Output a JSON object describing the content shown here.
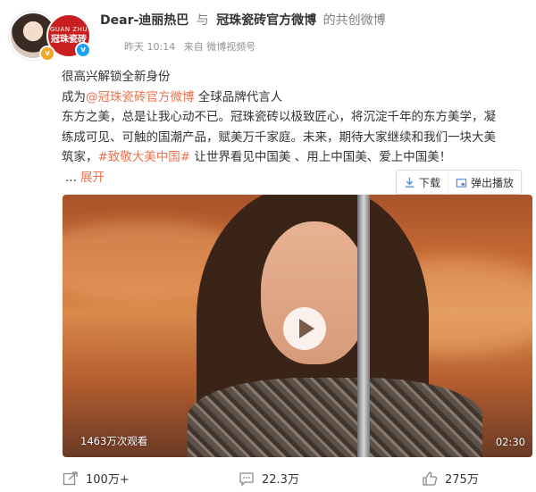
{
  "header": {
    "author": "Dear-迪丽热巴",
    "connector": "与",
    "coauthor": "冠珠瓷砖官方微博",
    "suffix": "的共创微博",
    "time": "昨天 10:14",
    "source": "来自 微博视频号",
    "brand_avatar_en": "GUAN ZHU",
    "brand_avatar_cn": "冠珠瓷砖"
  },
  "post": {
    "line1": "很高兴解锁全新身份",
    "line2_prefix": "成为",
    "line2_link": "@冠珠瓷砖官方微博",
    "line2_suffix": " 全球品牌代言人",
    "line3a": "东方之美，总是让我心动不已。冠珠瓷砖以极致匠心，将沉淀千年的东方美学，凝",
    "line3b": "练成可见、可触的国潮产品，赋美万千家庭。未来，期待大家继续和我们一块大美",
    "line3c_prefix": "筑家，",
    "hashtag": "#致敬大美中国#",
    "line3c_suffix": " 让世界看见中国美 、用上中国美、爱上中国美！",
    "ellipsis": "...",
    "expand": "展开"
  },
  "video_toolbar": {
    "download": "下载",
    "popout": "弹出播放"
  },
  "video": {
    "views": "1463万次观看",
    "duration": "02:30"
  },
  "actions": {
    "share_count": "100万+",
    "comment_count": "22.3万",
    "like_count": "275万"
  },
  "colors": {
    "link": "#eb7350",
    "brand": "#c91f1f",
    "verified": "#1da1f2",
    "vip": "#f5a623"
  }
}
